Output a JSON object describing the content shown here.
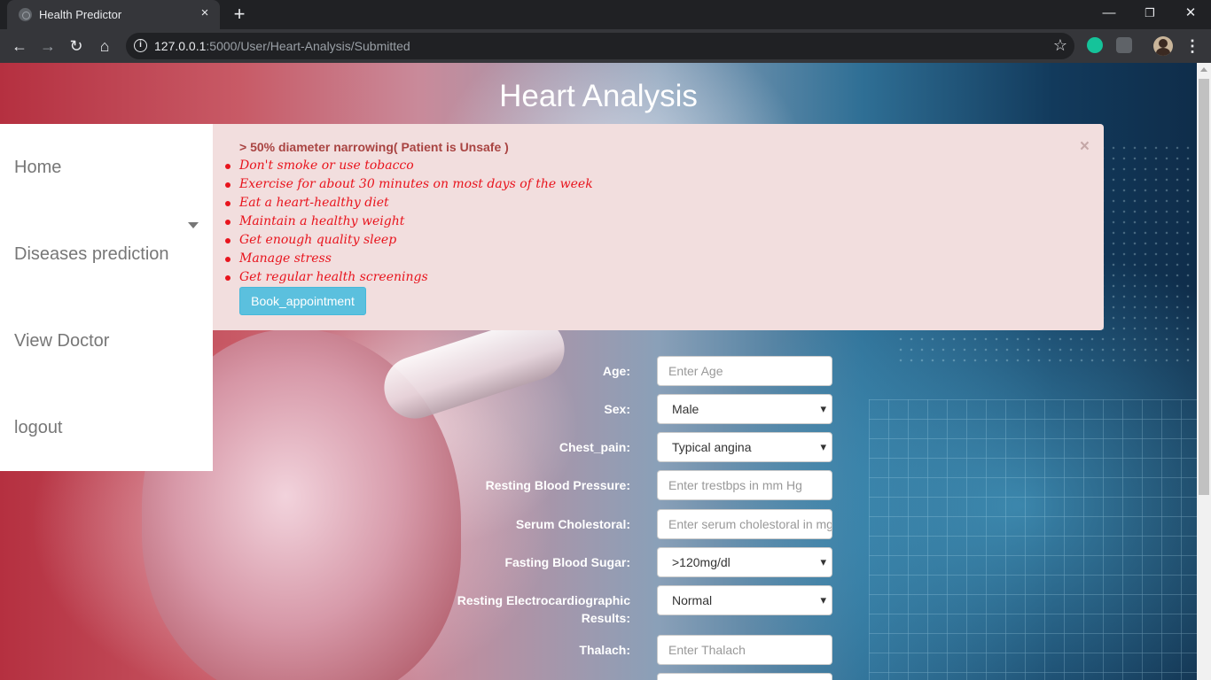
{
  "browser": {
    "tab_title": "Health Predictor",
    "tab_close": "×",
    "new_tab": "+",
    "url_host": "127.0.0.1",
    "url_path": ":5000/User/Heart-Analysis/Submitted",
    "window_controls": [
      "—",
      "❐",
      "✕"
    ]
  },
  "page": {
    "title": "Heart Analysis"
  },
  "sidebar": {
    "items": [
      {
        "label": "Home"
      },
      {
        "label": "Diseases prediction"
      },
      {
        "label": "View Doctor"
      },
      {
        "label": "logout"
      }
    ]
  },
  "alert": {
    "headline": "> 50% diameter narrowing( Patient is Unsafe )",
    "dismiss": "×",
    "tips": [
      "Don't smoke or use tobacco",
      "Exercise for about 30 minutes on most days of the week",
      "Eat a heart-healthy diet",
      "Maintain a healthy weight",
      "Get enough quality sleep",
      "Manage stress",
      "Get regular health screenings"
    ],
    "button": "Book_appointment",
    "color": "#a94442"
  },
  "form": {
    "age": {
      "label": "Age:",
      "placeholder": "Enter Age"
    },
    "sex": {
      "label": "Sex:",
      "value": "Male"
    },
    "chest_pain": {
      "label": "Chest_pain:",
      "value": "Typical angina"
    },
    "resting_bp": {
      "label": "Resting Blood Pressure:",
      "placeholder": "Enter trestbps in mm Hg"
    },
    "serum_chol": {
      "label": "Serum Cholestoral:",
      "placeholder": "Enter serum cholestoral in mg/dl"
    },
    "fasting_bs": {
      "label": "Fasting Blood Sugar:",
      "value": ">120mg/dl"
    },
    "rest_ecg": {
      "label_line1": "Resting Electrocardiographic",
      "label_line2": "Results:",
      "value": "Normal"
    },
    "thalach": {
      "label": "Thalach:",
      "placeholder": "Enter Thalach"
    }
  },
  "colors": {
    "accent_button": "#5bc0de",
    "tip_text": "#e8141d"
  }
}
